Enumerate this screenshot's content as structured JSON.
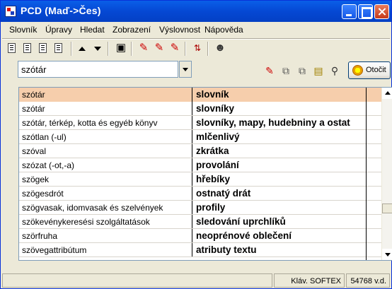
{
  "window": {
    "title": "PCD (Maď->Čes)"
  },
  "menu": [
    "Slovník",
    "Úpravy",
    "Hledat",
    "Zobrazení",
    "Výslovnost",
    "Nápověda"
  ],
  "search": {
    "value": "szótár"
  },
  "otocit_label": "Otočit",
  "toolbar_icons": [
    "document-icon",
    "document-icon",
    "document-icon",
    "document-icon",
    "arrow-up-icon",
    "arrow-down-icon",
    "picture-icon",
    "marker-icon",
    "marker-icon",
    "marker-icon",
    "auto-translate-icon",
    "speaker-person-icon"
  ],
  "entries": [
    {
      "hu": "szótár",
      "cz": "slovník",
      "selected": true
    },
    {
      "hu": "szótár",
      "cz": "slovníky"
    },
    {
      "hu": "szótár, térkép, kotta és egyéb könyv",
      "cz": "slovníky, mapy, hudebniny a ostat"
    },
    {
      "hu": "szótlan (-ul)",
      "cz": "mlčenlivý"
    },
    {
      "hu": "szóval",
      "cz": "zkrátka"
    },
    {
      "hu": "szózat (-ot,-a)",
      "cz": "provolání"
    },
    {
      "hu": "szögek",
      "cz": "hřebíky"
    },
    {
      "hu": "szögesdrót",
      "cz": "ostnatý drát"
    },
    {
      "hu": "szögvasak, idomvasak és szelvények",
      "cz": "profily"
    },
    {
      "hu": "szökevénykeresési szolgáltatások",
      "cz": "sledování uprchlíků"
    },
    {
      "hu": "szörfruha",
      "cz": "neoprénové oblečení"
    },
    {
      "hu": "szövegattribútum",
      "cz": "atributy textu"
    }
  ],
  "status": {
    "main": "",
    "keyboard": "Kláv. SOFTEX",
    "count": "54768 v.d."
  },
  "colors": {
    "selection": "#f6ceac",
    "titlebar": "#0548d4"
  }
}
